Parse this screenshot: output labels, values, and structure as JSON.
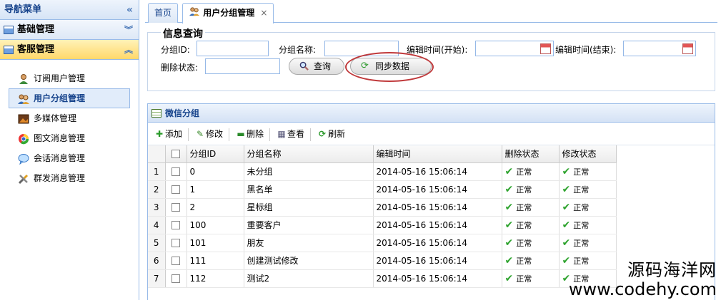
{
  "sidebar": {
    "title": "导航菜单",
    "groups": [
      {
        "label": "基础管理"
      },
      {
        "label": "客服管理"
      }
    ],
    "items": [
      {
        "label": "订阅用户管理"
      },
      {
        "label": "用户分组管理"
      },
      {
        "label": "多媒体管理"
      },
      {
        "label": "图文消息管理"
      },
      {
        "label": "会话消息管理"
      },
      {
        "label": "群发消息管理"
      }
    ]
  },
  "tabs": [
    {
      "label": "首页"
    },
    {
      "label": "用户分组管理",
      "close": "×"
    }
  ],
  "query": {
    "legend": "信息查询",
    "group_id_label": "分组ID:",
    "group_name_label": "分组名称:",
    "edit_start_label": "编辑时间(开始):",
    "edit_end_label": "编辑时间(结束):",
    "delete_status_label": "删除状态:",
    "search_button": "查询",
    "sync_button": "同步数据"
  },
  "grid": {
    "title": "微信分组",
    "toolbar": {
      "add": "添加",
      "edit": "修改",
      "delete": "删除",
      "view": "查看",
      "refresh": "刷新"
    },
    "columns": [
      "分组ID",
      "分组名称",
      "编辑时间",
      "删除状态",
      "修改状态"
    ],
    "rows": [
      {
        "no": "1",
        "id": "0",
        "name": "未分组",
        "time": "2014-05-16 15:06:14",
        "del": "正常",
        "mod": "正常"
      },
      {
        "no": "2",
        "id": "1",
        "name": "黑名单",
        "time": "2014-05-16 15:06:14",
        "del": "正常",
        "mod": "正常"
      },
      {
        "no": "3",
        "id": "2",
        "name": "星标组",
        "time": "2014-05-16 15:06:14",
        "del": "正常",
        "mod": "正常"
      },
      {
        "no": "4",
        "id": "100",
        "name": "重要客户",
        "time": "2014-05-16 15:06:14",
        "del": "正常",
        "mod": "正常"
      },
      {
        "no": "5",
        "id": "101",
        "name": "朋友",
        "time": "2014-05-16 15:06:14",
        "del": "正常",
        "mod": "正常"
      },
      {
        "no": "6",
        "id": "111",
        "name": "创建测试修改",
        "time": "2014-05-16 15:06:14",
        "del": "正常",
        "mod": "正常"
      },
      {
        "no": "7",
        "id": "112",
        "name": "测试2",
        "time": "2014-05-16 15:06:14",
        "del": "正常",
        "mod": "正常"
      }
    ]
  },
  "watermark": {
    "line1": "源码海洋网",
    "line2": "www.codehy.com"
  },
  "colors": {
    "accent": "#15428b",
    "border": "#99bbe8",
    "active_group": "#ffd86a",
    "highlight_ring": "#c0393b",
    "ok_check": "#2ea32e"
  }
}
